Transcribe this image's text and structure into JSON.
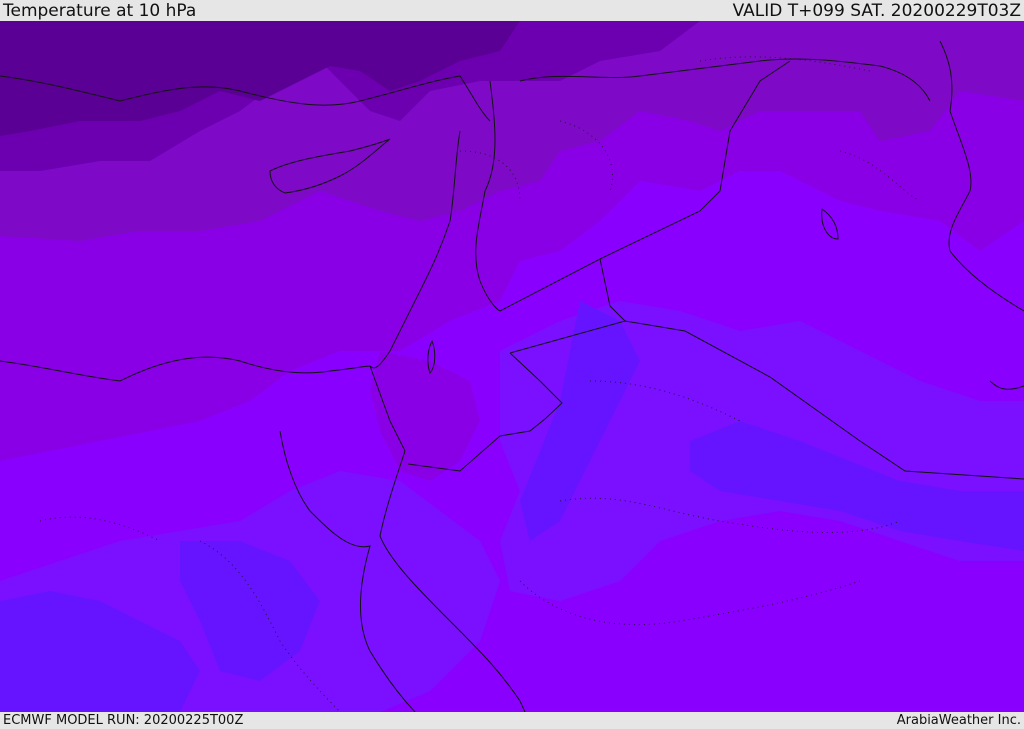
{
  "header": {
    "title": "Temperature at 10 hPa",
    "valid": "VALID T+099 SAT. 20200229T03Z"
  },
  "footer": {
    "model_run": "ECMWF MODEL RUN: 20200225T00Z",
    "credit": "ArabiaWeather Inc."
  },
  "palette": {
    "coldest": "#5a0094",
    "colder": "#6c00b0",
    "cold": "#7e0ac8",
    "mid": "#8a00e6",
    "warm": "#8a00ff",
    "warmer": "#7a10ff",
    "warmest": "#6614ff",
    "outline": "#141414"
  }
}
